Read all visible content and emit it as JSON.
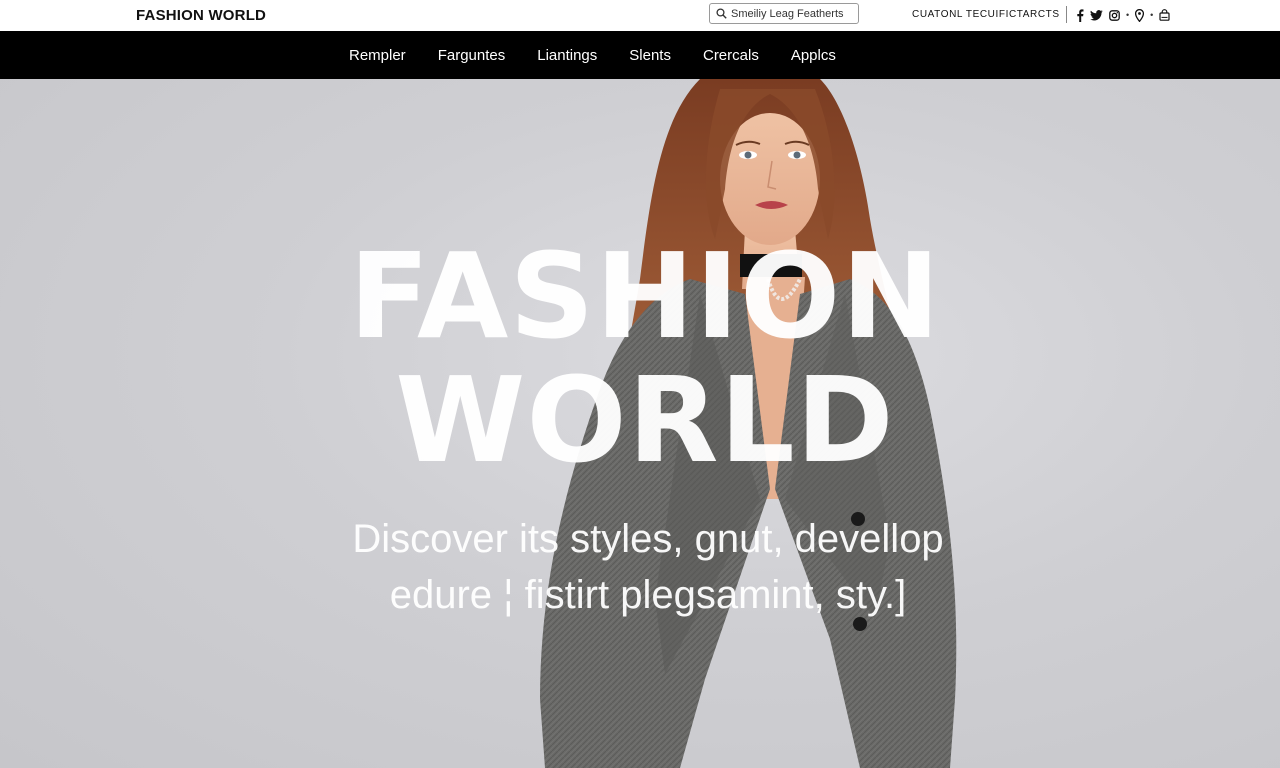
{
  "header": {
    "brand": "FASHION WORLD",
    "search_placeholder": "Smeiliy Leag Featherts",
    "utility_link": "CUATONL TECUIFICTARCTS",
    "social_icons": [
      "facebook-icon",
      "twitter-icon",
      "instagram-icon",
      "location-pin-icon",
      "cart-icon"
    ]
  },
  "nav": {
    "items": [
      "Rempler",
      "Farguntes",
      "Liantings",
      "Slents",
      "Crercals",
      "Applcs"
    ]
  },
  "hero": {
    "title_line1": "FASHION",
    "title_line2": "WORLD",
    "subtitle_line1": "Discover its styles, gnut, devellop",
    "subtitle_line2": "edure ¦ fistirt plegsamint, sty.]"
  },
  "colors": {
    "nav_background": "#000000",
    "topbar_background": "#ffffff",
    "hero_background": "#cfcfd3",
    "hero_text": "#ffffff"
  }
}
